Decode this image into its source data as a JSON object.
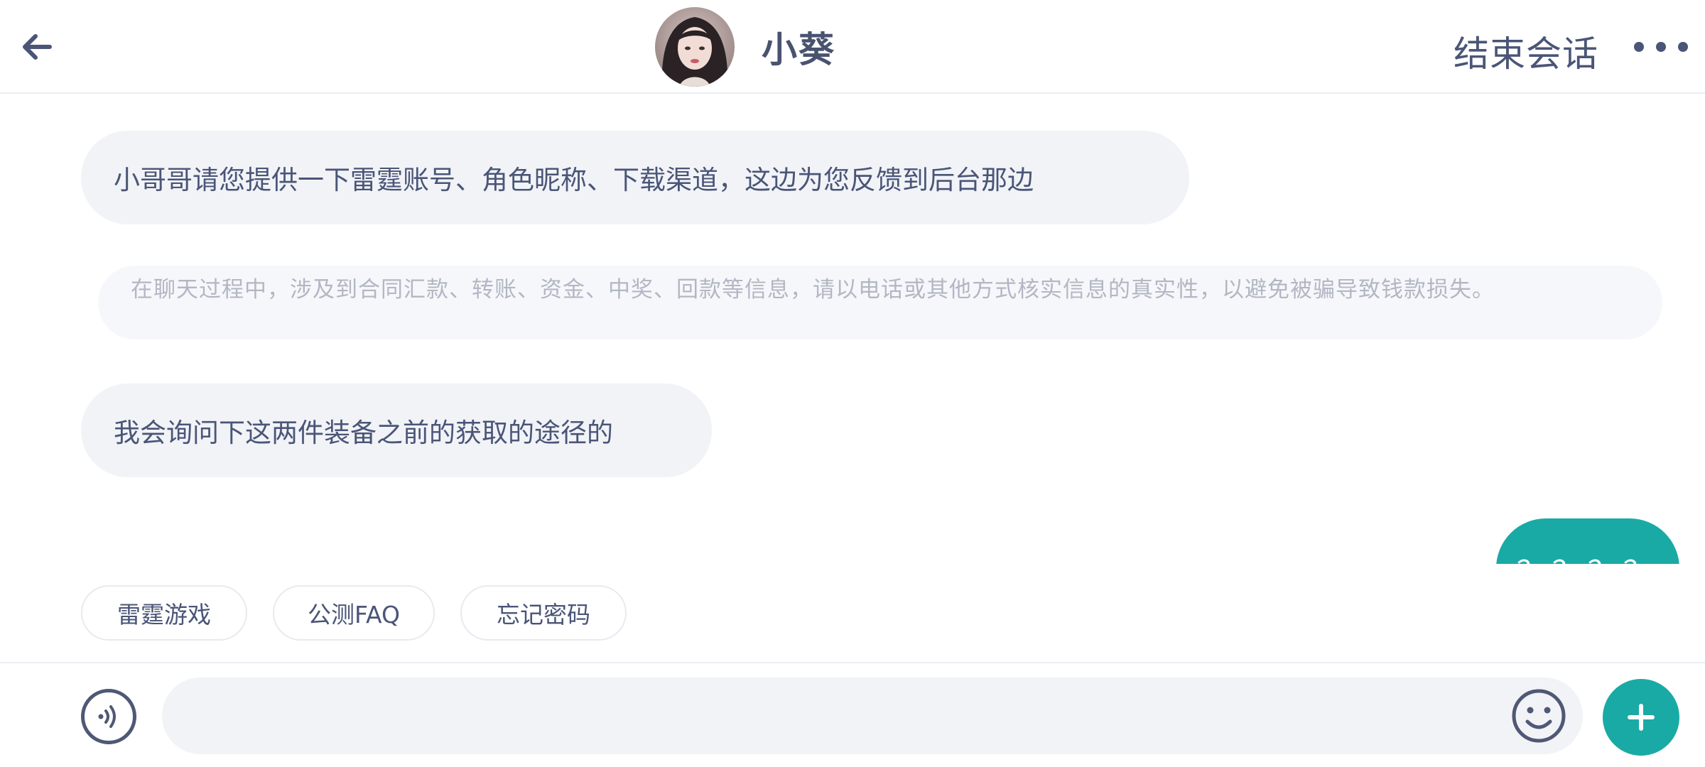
{
  "header": {
    "agent_name": "小葵",
    "end_session_label": "结束会话",
    "back_icon": "arrow-left-icon",
    "more_icon": "more-horizontal-icon"
  },
  "messages": [
    {
      "side": "left",
      "text": "小哥哥请您提供一下雷霆账号、角色昵称、下载渠道，这边为您反馈到后台那边"
    },
    {
      "side": "system",
      "text": "在聊天过程中，涉及到合同汇款、转账、资金、中奖、回款等信息，请以电话或其他方式核实信息的真实性，以避免被骗导致钱款损失。"
    },
    {
      "side": "left",
      "text": "我会询问下这两件装备之前的获取的途径的"
    },
    {
      "side": "right",
      "text": "？？？？"
    }
  ],
  "quick_replies": [
    "雷霆游戏",
    "公测FAQ",
    "忘记密码"
  ],
  "input": {
    "value": "",
    "placeholder": "",
    "voice_icon": "voice-icon",
    "emoji_icon": "emoji-icon",
    "plus_icon": "plus-icon"
  },
  "colors": {
    "accent": "#1aaaa5",
    "text": "#4a5577",
    "bubble_bg": "#f1f3f7"
  }
}
